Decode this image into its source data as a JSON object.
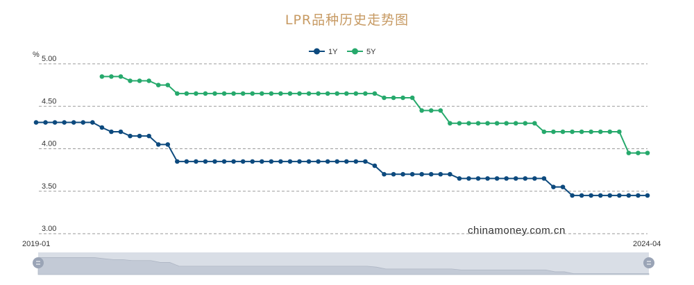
{
  "chart_data": {
    "type": "line",
    "title": "LPR品种历史走势图",
    "ylabel": "%",
    "ylim": [
      3.0,
      5.0
    ],
    "y_ticks": [
      "5.00",
      "4.50",
      "4.00",
      "3.50",
      "3.00"
    ],
    "x_range_labels": [
      "2019-01",
      "2024-04"
    ],
    "x_start": "2019-01",
    "x_end": "2024-04",
    "grid": "horizontal-dashed",
    "legend_placement": "top-center",
    "watermark": "chinamoney.com.cn",
    "series": [
      {
        "name": "1Y",
        "color": "#0d4a7e",
        "values": [
          4.31,
          4.31,
          4.31,
          4.31,
          4.31,
          4.31,
          4.31,
          4.25,
          4.2,
          4.2,
          4.15,
          4.15,
          4.15,
          4.05,
          4.05,
          3.85,
          3.85,
          3.85,
          3.85,
          3.85,
          3.85,
          3.85,
          3.85,
          3.85,
          3.85,
          3.85,
          3.85,
          3.85,
          3.85,
          3.85,
          3.85,
          3.85,
          3.85,
          3.85,
          3.85,
          3.85,
          3.8,
          3.7,
          3.7,
          3.7,
          3.7,
          3.7,
          3.7,
          3.7,
          3.7,
          3.65,
          3.65,
          3.65,
          3.65,
          3.65,
          3.65,
          3.65,
          3.65,
          3.65,
          3.65,
          3.55,
          3.55,
          3.45,
          3.45,
          3.45,
          3.45,
          3.45,
          3.45,
          3.45,
          3.45,
          3.45
        ]
      },
      {
        "name": "5Y",
        "color": "#26a96c",
        "values": [
          null,
          null,
          null,
          null,
          null,
          null,
          null,
          4.85,
          4.85,
          4.85,
          4.8,
          4.8,
          4.8,
          4.75,
          4.75,
          4.65,
          4.65,
          4.65,
          4.65,
          4.65,
          4.65,
          4.65,
          4.65,
          4.65,
          4.65,
          4.65,
          4.65,
          4.65,
          4.65,
          4.65,
          4.65,
          4.65,
          4.65,
          4.65,
          4.65,
          4.65,
          4.65,
          4.6,
          4.6,
          4.6,
          4.6,
          4.45,
          4.45,
          4.45,
          4.3,
          4.3,
          4.3,
          4.3,
          4.3,
          4.3,
          4.3,
          4.3,
          4.3,
          4.3,
          4.2,
          4.2,
          4.2,
          4.2,
          4.2,
          4.2,
          4.2,
          4.2,
          4.2,
          3.95,
          3.95,
          3.95
        ]
      }
    ]
  },
  "colors": {
    "grid": "#9a9a9a",
    "slider_bg": "#d9dee6",
    "slider_area": "#c3cad6",
    "slider_handle": "#9aa4b6"
  }
}
